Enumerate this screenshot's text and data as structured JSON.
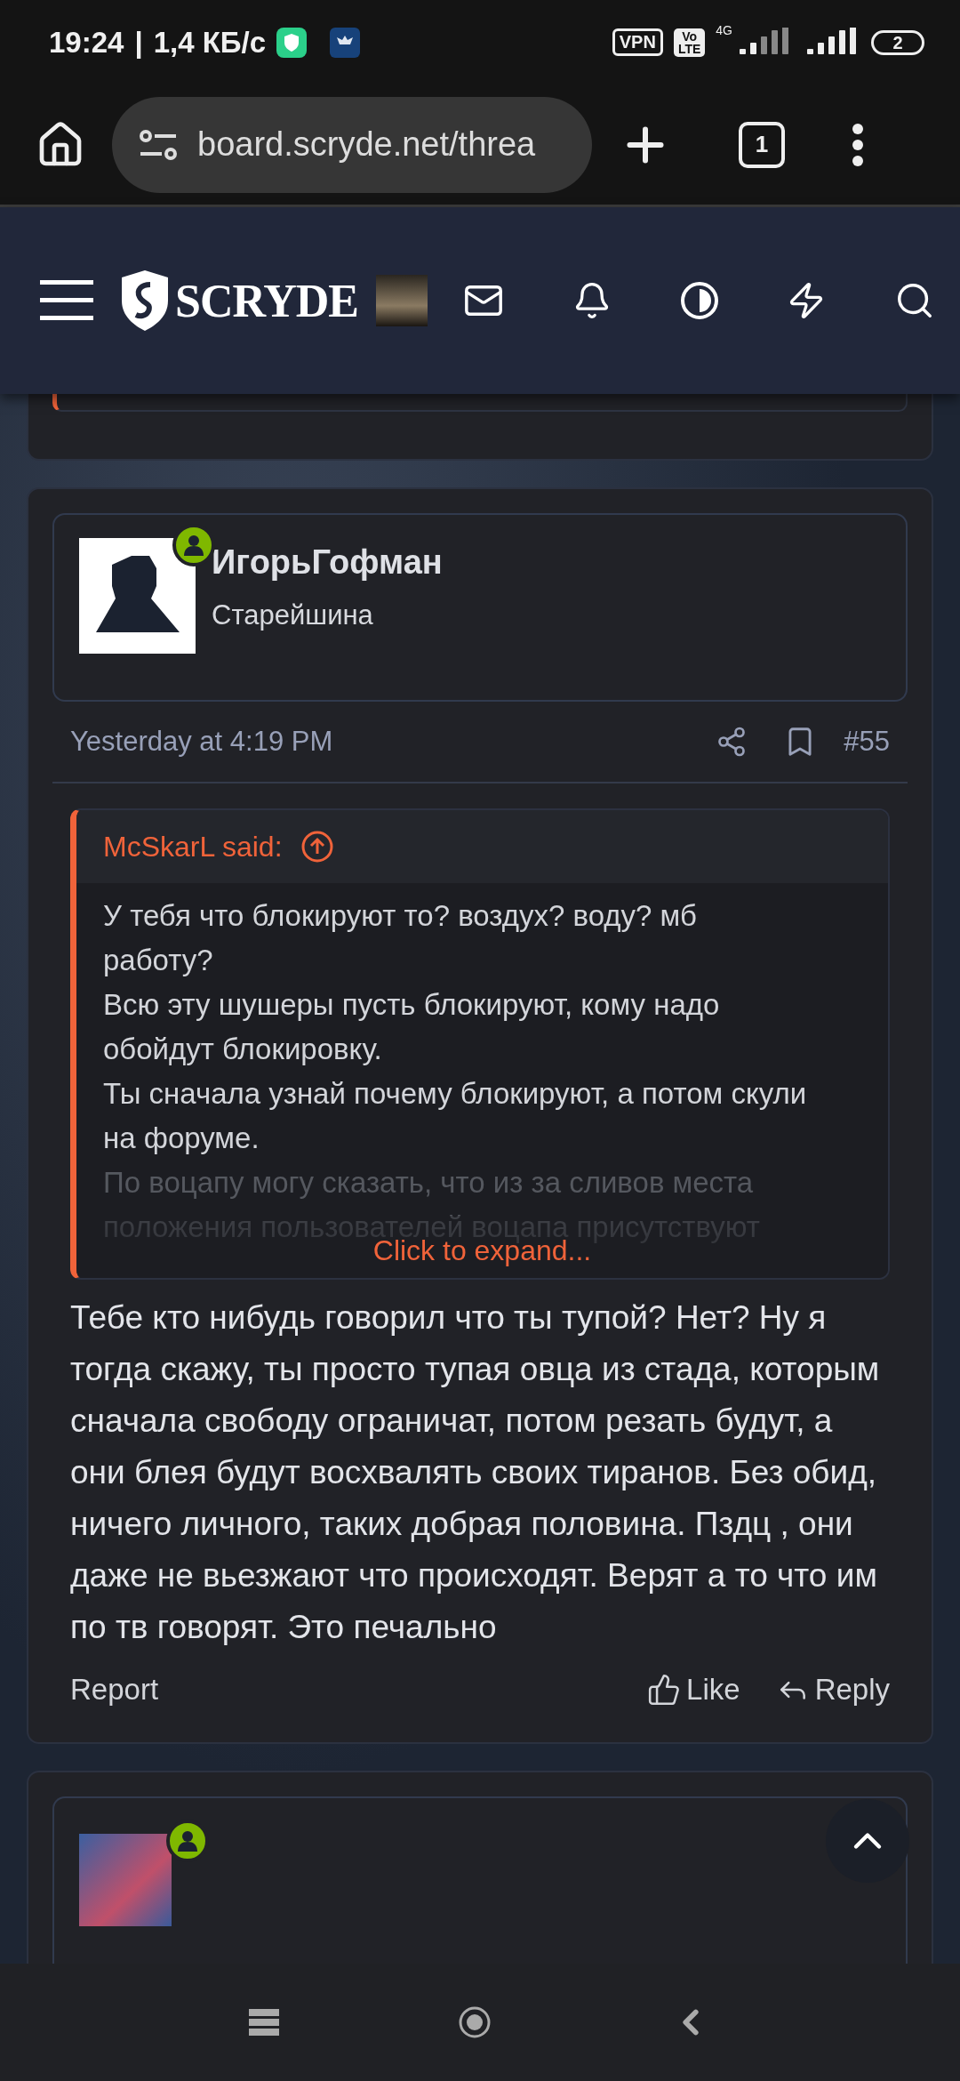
{
  "status_bar": {
    "time": "19:24",
    "separator": "|",
    "speed": "1,4 КБ/с",
    "vpn": "VPN",
    "volte_top": "Vo",
    "volte_bottom": "LTE",
    "network": "4G",
    "battery": "2"
  },
  "browser": {
    "url": "board.scryde.net/threa",
    "tab_count": "1"
  },
  "site_header": {
    "logo": "SCRYDE"
  },
  "post": {
    "author": "ИгорьГофман",
    "rank": "Старейшина",
    "online": true,
    "date": "Yesterday at 4:19 PM",
    "number": "#55",
    "quote": {
      "author": "McSkarL said:",
      "paragraphs": [
        "У тебя что блокируют то? воздух? воду? мб работу?",
        "Всю эту шушеры пусть блокируют, кому надо обойдут блокировку.",
        "Ты сначала узнай почему блокируют, а потом скули на форуме."
      ],
      "faded": "По воцапу могу сказать, что из за сливов места положения пользователей воцапа присутствуют",
      "expand": "Click to expand..."
    },
    "body": "Тебе кто нибудь говорил что ты тупой? Нет? Ну я тогда скажу, ты просто тупая овца из стада, которым сначала свободу ограничат, потом резать будут, а они блея будут восхвалять своих тиранов. Без обид, ничего личного, таких добрая половина. Пздц , они даже не вьезжают что происходят. Верят а то что им по тв говорят. Это печально",
    "actions": {
      "report": "Report",
      "like": "Like",
      "reply": "Reply"
    }
  },
  "next_post": {
    "online": true
  }
}
